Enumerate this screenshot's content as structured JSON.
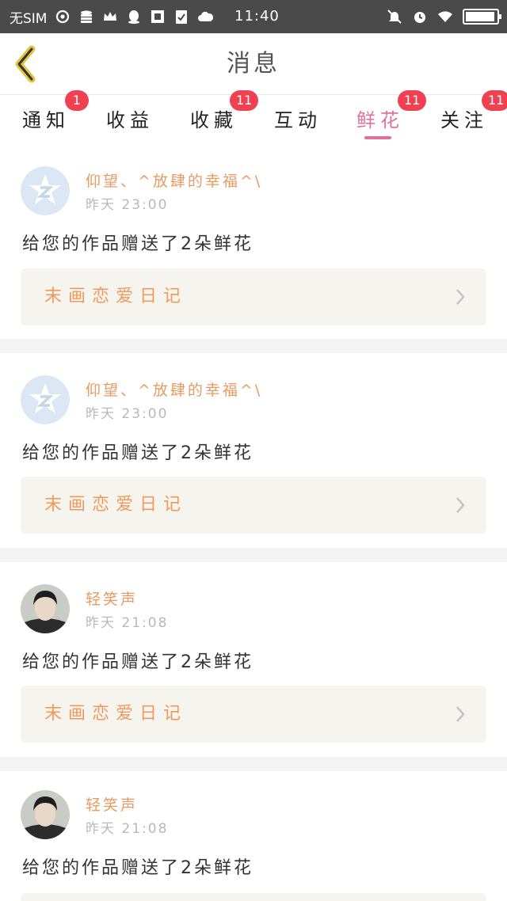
{
  "status_bar": {
    "carrier": "无SIM",
    "time": "11:40",
    "battery_level": 0.95
  },
  "header": {
    "title": "消息",
    "back_icon": "chevron-left-icon"
  },
  "tabs": [
    {
      "label": "通知",
      "badge": "1",
      "active": false
    },
    {
      "label": "收益",
      "badge": "",
      "active": false
    },
    {
      "label": "收藏",
      "badge": "11",
      "active": false
    },
    {
      "label": "互动",
      "badge": "",
      "active": false
    },
    {
      "label": "鲜花",
      "badge": "11",
      "active": true
    },
    {
      "label": "关注",
      "badge": "11",
      "active": false
    }
  ],
  "messages": [
    {
      "username": "仰望、^放肆的幸福^\\",
      "time": "昨天 23:00",
      "text": "给您的作品赠送了2朵鲜花",
      "work_title": "末画恋爱日记",
      "avatar": "qq-default-avatar"
    },
    {
      "username": "仰望、^放肆的幸福^\\",
      "time": "昨天 23:00",
      "text": "给您的作品赠送了2朵鲜花",
      "work_title": "末画恋爱日记",
      "avatar": "qq-default-avatar"
    },
    {
      "username": "轻笑声",
      "time": "昨天 21:08",
      "text": "给您的作品赠送了2朵鲜花",
      "work_title": "末画恋爱日记",
      "avatar": "photo-avatar"
    },
    {
      "username": "轻笑声",
      "time": "昨天 21:08",
      "text": "给您的作品赠送了2朵鲜花",
      "work_title": "",
      "avatar": "photo-avatar"
    }
  ],
  "colors": {
    "accent": "#e0719d",
    "username": "#e89a62",
    "badge": "#ef4150",
    "work_card_bg": "#f6f4ee"
  }
}
